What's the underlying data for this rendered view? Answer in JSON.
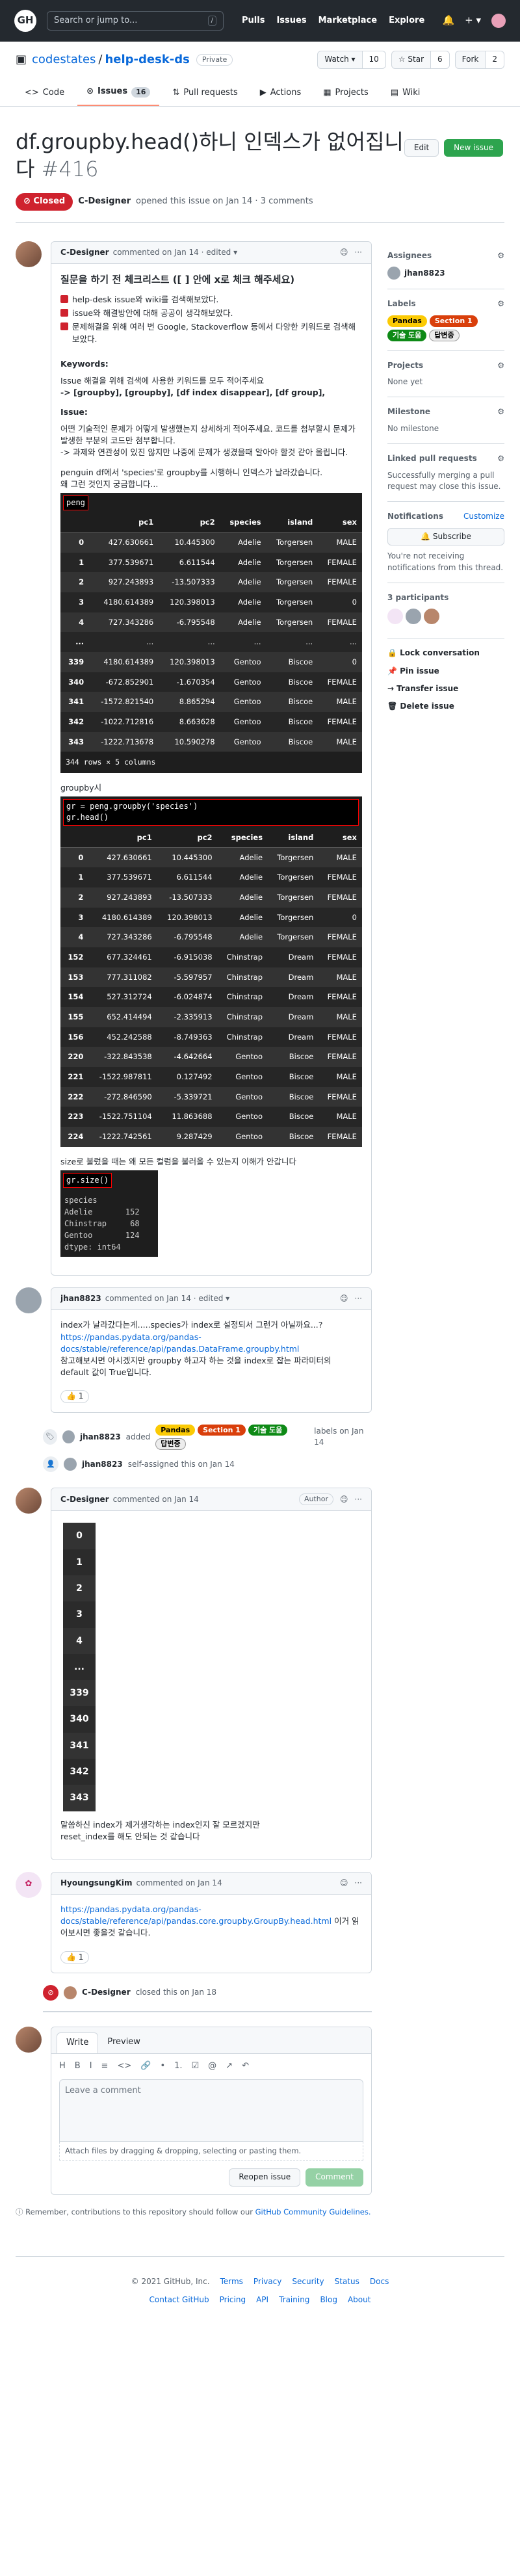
{
  "topbar": {
    "logo": "GH",
    "search_placeholder": "Search or jump to...",
    "slash": "/",
    "nav": [
      "Pulls",
      "Issues",
      "Marketplace",
      "Explore"
    ],
    "bell": "🔔",
    "plus": "+ ▾"
  },
  "repo": {
    "owner": "codestates",
    "sep": "/",
    "name": "help-desk-ds",
    "visibility": "Private",
    "watch": "Watch ▾",
    "watch_count": "10",
    "star": "☆ Star",
    "star_count": "6",
    "fork": "Fork",
    "fork_count": "2"
  },
  "tabs": [
    {
      "label": "Code",
      "icon": "<>"
    },
    {
      "label": "Issues",
      "icon": "⊙",
      "count": "16"
    },
    {
      "label": "Pull requests",
      "icon": "⇅"
    },
    {
      "label": "Actions",
      "icon": "▶"
    },
    {
      "label": "Projects",
      "icon": "▦"
    },
    {
      "label": "Wiki",
      "icon": "▤"
    }
  ],
  "issue": {
    "title": "df.groupby.head()하니 인덱스가 없어집니다",
    "number": "#416",
    "edit": "Edit",
    "new_issue": "New issue",
    "status": "Closed",
    "meta_user": "C-Designer",
    "meta_text": "opened this issue on Jan 14 · 3 comments"
  },
  "c1": {
    "user": "C-Designer",
    "text": "commented on Jan 14 · edited ▾",
    "heading": "질문을 하기 전 체크리스트 ([ ] 안에 x로 체크 해주세요)",
    "checks": [
      "help-desk issue와 wiki를 검색해보았다.",
      "issue와 해결방안에 대해 공공이 생각해보았다.",
      "문제해결을 위해 여러 번 Google, Stackoverflow 등에서 다양한 키워드로 검색해 보았다."
    ],
    "kw_label": "Keywords:",
    "kw1": "Issue 해결을 위해 검색에 사용한 키워드를 모두 적어주세요",
    "kw2": "-> [groupby], [groupby], [df index disappear], [df group],",
    "issue_label": "Issue:",
    "issue1": "어떤 기술적인 문제가 어떻게 발생했는지 상세하게 적어주세요. 코드를 첨부할시 문제가 발생한 부분의 코드만 첨부합니다.",
    "issue2": "-> 과제와 연관성이 있진 않지만 나중에 문제가 생겼을때 알아야 할것 같아 올립니다.",
    "issue3": "penguin df에서 'species'로 groupby를 시행하니 인덱스가 날라갔습니다.",
    "issue4": "왜 그런 것인지 궁금합니다...",
    "cell1": "peng",
    "df_cols": [
      "",
      "pc1",
      "pc2",
      "species",
      "island",
      "sex"
    ],
    "df1": [
      [
        "0",
        "427.630661",
        "10.445300",
        "Adelie",
        "Torgersen",
        "MALE"
      ],
      [
        "1",
        "377.539671",
        "6.611544",
        "Adelie",
        "Torgersen",
        "FEMALE"
      ],
      [
        "2",
        "927.243893",
        "-13.507333",
        "Adelie",
        "Torgersen",
        "FEMALE"
      ],
      [
        "3",
        "4180.614389",
        "120.398013",
        "Adelie",
        "Torgersen",
        "0"
      ],
      [
        "4",
        "727.343286",
        "-6.795548",
        "Adelie",
        "Torgersen",
        "FEMALE"
      ],
      [
        "...",
        "...",
        "...",
        "...",
        "...",
        "..."
      ],
      [
        "339",
        "4180.614389",
        "120.398013",
        "Gentoo",
        "Biscoe",
        "0"
      ],
      [
        "340",
        "-672.852901",
        "-1.670354",
        "Gentoo",
        "Biscoe",
        "FEMALE"
      ],
      [
        "341",
        "-1572.821540",
        "8.865294",
        "Gentoo",
        "Biscoe",
        "MALE"
      ],
      [
        "342",
        "-1022.712816",
        "8.663628",
        "Gentoo",
        "Biscoe",
        "FEMALE"
      ],
      [
        "343",
        "-1222.713678",
        "10.590278",
        "Gentoo",
        "Biscoe",
        "MALE"
      ]
    ],
    "df1_note": "344 rows × 5 columns",
    "groupby_label": "groupby시",
    "code2a": "gr = peng.groupby('species')",
    "code2b": "gr.head()",
    "df2": [
      [
        "0",
        "427.630661",
        "10.445300",
        "Adelie",
        "Torgersen",
        "MALE"
      ],
      [
        "1",
        "377.539671",
        "6.611544",
        "Adelie",
        "Torgersen",
        "FEMALE"
      ],
      [
        "2",
        "927.243893",
        "-13.507333",
        "Adelie",
        "Torgersen",
        "FEMALE"
      ],
      [
        "3",
        "4180.614389",
        "120.398013",
        "Adelie",
        "Torgersen",
        "0"
      ],
      [
        "4",
        "727.343286",
        "-6.795548",
        "Adelie",
        "Torgersen",
        "FEMALE"
      ],
      [
        "152",
        "677.324461",
        "-6.915038",
        "Chinstrap",
        "Dream",
        "FEMALE"
      ],
      [
        "153",
        "777.311082",
        "-5.597957",
        "Chinstrap",
        "Dream",
        "MALE"
      ],
      [
        "154",
        "527.312724",
        "-6.024874",
        "Chinstrap",
        "Dream",
        "FEMALE"
      ],
      [
        "155",
        "652.414494",
        "-2.335913",
        "Chinstrap",
        "Dream",
        "MALE"
      ],
      [
        "156",
        "452.242588",
        "-8.749363",
        "Chinstrap",
        "Dream",
        "FEMALE"
      ],
      [
        "220",
        "-322.843538",
        "-4.642664",
        "Gentoo",
        "Biscoe",
        "FEMALE"
      ],
      [
        "221",
        "-1522.987811",
        "0.127492",
        "Gentoo",
        "Biscoe",
        "MALE"
      ],
      [
        "222",
        "-272.846590",
        "-5.339721",
        "Gentoo",
        "Biscoe",
        "FEMALE"
      ],
      [
        "223",
        "-1522.751104",
        "11.863688",
        "Gentoo",
        "Biscoe",
        "MALE"
      ],
      [
        "224",
        "-1222.742561",
        "9.287429",
        "Gentoo",
        "Biscoe",
        "FEMALE"
      ]
    ],
    "size_label": "size로 불렀을 때는 왜 모든 컬럼을 불러올 수 있는지 이해가 안갑니다",
    "code3": "gr.size()",
    "size_out": "species\nAdelie       152\nChinstrap     68\nGentoo       124\ndtype: int64"
  },
  "c2": {
    "user": "jhan8823",
    "text": "commented on Jan 14 · edited ▾",
    "p1": "index가 날라갔다는게.....species가 index로 설정되서 그런거 아닐까요...?",
    "link": "https://pandas.pydata.org/pandas-docs/stable/reference/api/pandas.DataFrame.groupby.html",
    "p2": "참고해보시면 아시겠지만 groupby 하고자 하는 것을 index로 잡는 파라미터의 default 값이 True입니다.",
    "reaction": "👍 1"
  },
  "ev1": {
    "user": "jhan8823",
    "text": "added",
    "labels": [
      {
        "name": "Pandas",
        "bg": "#fbca04",
        "fg": "#000"
      },
      {
        "name": "Section 1",
        "bg": "#d93f0b",
        "fg": "#fff"
      },
      {
        "name": "기술 도움",
        "bg": "#0e8a16",
        "fg": "#fff"
      },
      {
        "name": "답변중",
        "bg": "#ededed",
        "fg": "#000"
      }
    ],
    "suffix": "labels on Jan 14"
  },
  "ev2": {
    "user": "jhan8823",
    "text": "self-assigned this on Jan 14"
  },
  "c3": {
    "user": "C-Designer",
    "text": "commented on Jan 14",
    "role": "Author",
    "idx": [
      "0",
      "1",
      "2",
      "3",
      "4",
      "...",
      "339",
      "340",
      "341",
      "342",
      "343"
    ],
    "p1": "말씀하신 index가 제거생각하는 index인지 잘 모르겠지만",
    "p2": "reset_index를 해도 안되는 것 같습니다"
  },
  "c4": {
    "user": "HyoungsungKim",
    "text": "commented on Jan 14",
    "link": "https://pandas.pydata.org/pandas-docs/stable/reference/api/pandas.core.groupby.GroupBy.head.html",
    "p1": "이거 읽어보시면 좋을것 같습니다.",
    "reaction": "👍 1"
  },
  "ev3": {
    "user": "C-Designer",
    "text": "closed this on Jan 18"
  },
  "editor": {
    "write": "Write",
    "preview": "Preview",
    "tools": [
      "H",
      "B",
      "I",
      "≡",
      "<>",
      "🔗",
      "•",
      "1.",
      "☑",
      "@",
      "↗",
      "↶"
    ],
    "placeholder": "Leave a comment",
    "attach": "Attach files by dragging & dropping, selecting or pasting them.",
    "reopen": "Reopen issue",
    "comment": "Comment",
    "remember": "Remember, contributions to this repository should follow our",
    "guidelines": "GitHub Community Guidelines."
  },
  "sidebar": {
    "assignees": "Assignees",
    "assignee": "jhan8823",
    "labels": "Labels",
    "projects": "Projects",
    "none_yet": "None yet",
    "milestone": "Milestone",
    "no_milestone": "No milestone",
    "linked": "Linked pull requests",
    "linked_text": "Successfully merging a pull request may close this issue.",
    "notifications": "Notifications",
    "customize": "Customize",
    "subscribe": "🔔 Subscribe",
    "notif_text": "You're not receiving notifications from this thread.",
    "participants": "3 participants",
    "lock": "🔒 Lock conversation",
    "pin": "📌 Pin issue",
    "transfer": "→ Transfer issue",
    "delete": "🗑 Delete issue"
  },
  "footer": {
    "copy": "© 2021 GitHub, Inc.",
    "links1": [
      "Terms",
      "Privacy",
      "Security",
      "Status",
      "Docs"
    ],
    "links2": [
      "Contact GitHub",
      "Pricing",
      "API",
      "Training",
      "Blog",
      "About"
    ]
  }
}
